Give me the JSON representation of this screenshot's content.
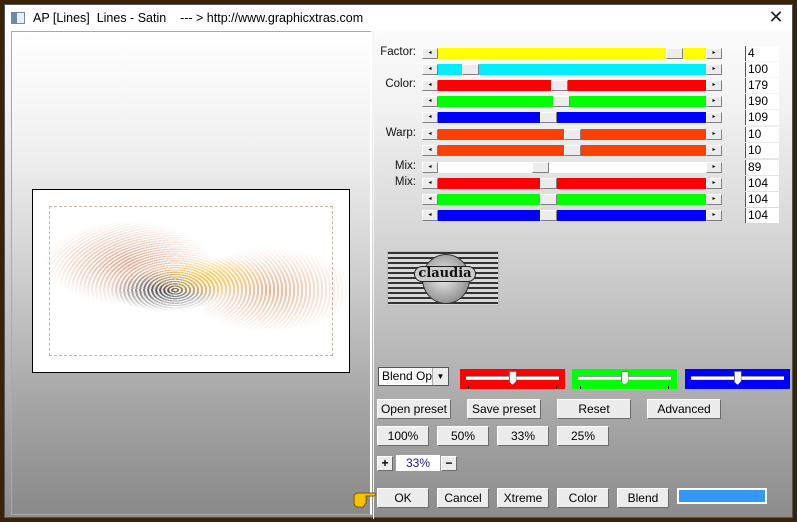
{
  "window": {
    "title": "AP [Lines]  Lines - Satin    --- > http://www.graphicxtras.com",
    "close_label": "✕"
  },
  "sliders": [
    {
      "label": "Factor:",
      "color": "#ffff00",
      "value": "4",
      "fraction": 0.88
    },
    {
      "label": "",
      "color": "#00eeff",
      "value": "100",
      "fraction": 0.12
    },
    {
      "label": "Color:",
      "color": "#ff0000",
      "value": "179",
      "fraction": 0.45
    },
    {
      "label": "",
      "color": "#00ff00",
      "value": "190",
      "fraction": 0.46
    },
    {
      "label": "",
      "color": "#0000ff",
      "value": "109",
      "fraction": 0.41
    },
    {
      "label": "Warp:",
      "color": "#ff4000",
      "value": "10",
      "fraction": 0.5
    },
    {
      "label": "",
      "color": "#ff4000",
      "value": "10",
      "fraction": 0.5
    },
    {
      "label": "Mix:",
      "color": "#ffffff",
      "value": "89",
      "fraction": 0.38
    },
    {
      "label": "Mix:",
      "color": "#ff0000",
      "value": "104",
      "fraction": 0.41
    },
    {
      "label": "",
      "color": "#00ff00",
      "value": "104",
      "fraction": 0.41
    },
    {
      "label": "",
      "color": "#0000ff",
      "value": "104",
      "fraction": 0.41
    }
  ],
  "logo": {
    "text": "claudia"
  },
  "blend": {
    "select_value": "Blend Opti",
    "color_sliders": [
      {
        "color": "#ff0000",
        "fraction": 0.5
      },
      {
        "color": "#00ff00",
        "fraction": 0.5
      },
      {
        "color": "#0000ff",
        "fraction": 0.5
      }
    ]
  },
  "preset_buttons": [
    "Open preset",
    "Save preset",
    "Reset",
    "Advanced"
  ],
  "zoom_buttons": [
    "100%",
    "50%",
    "33%",
    "25%"
  ],
  "zoom": {
    "plus_label": "+",
    "value": "33%",
    "minus_label": "−"
  },
  "action_buttons": [
    "OK",
    "Cancel",
    "Xtreme",
    "Color",
    "Blend"
  ],
  "swatch_color": "#3399ff"
}
